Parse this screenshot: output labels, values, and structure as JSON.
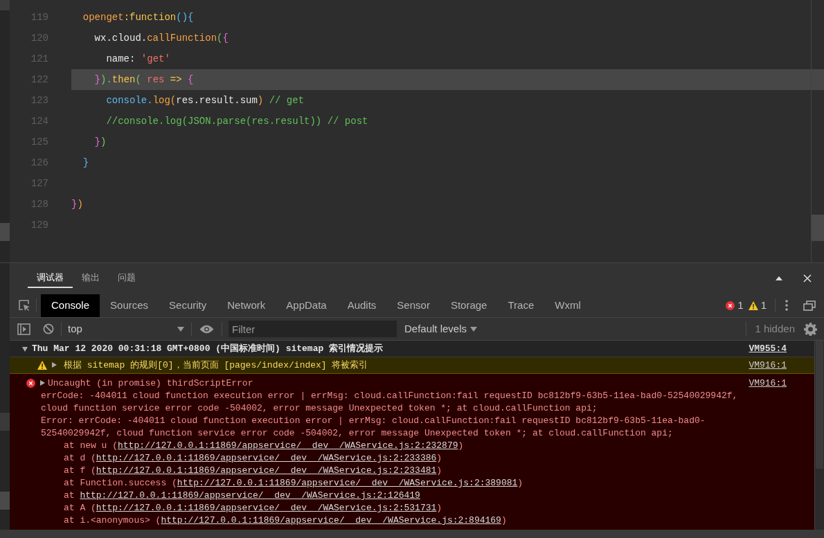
{
  "editor": {
    "lines": [
      {
        "number": "119",
        "current": false,
        "tokens": [
          {
            "t": "  openget",
            "color": "#f5a343"
          },
          {
            "t": ":function",
            "color": "#f7c948"
          },
          {
            "t": "(){",
            "color": "#5cb8f2"
          }
        ]
      },
      {
        "number": "120",
        "current": false,
        "tokens": [
          {
            "t": "    wx.cloud.",
            "color": "#e6e6e6"
          },
          {
            "t": "callFunction",
            "color": "#f5a343"
          },
          {
            "t": "(",
            "color": "#7fc46a"
          },
          {
            "t": "{",
            "color": "#e46bd6"
          }
        ]
      },
      {
        "number": "121",
        "current": false,
        "tokens": [
          {
            "t": "      name: ",
            "color": "#e6e6e6"
          },
          {
            "t": "'get'",
            "color": "#f0706a"
          }
        ]
      },
      {
        "number": "122",
        "current": true,
        "tokens": [
          {
            "t": "    }",
            "color": "#e46bd6"
          },
          {
            "t": ").",
            "color": "#7fc46a"
          },
          {
            "t": "then",
            "color": "#f7c948"
          },
          {
            "t": "( ",
            "color": "#7fc46a"
          },
          {
            "t": "res",
            "color": "#f0706a"
          },
          {
            "t": " => ",
            "color": "#f7c948"
          },
          {
            "t": "{",
            "color": "#e46bd6"
          }
        ]
      },
      {
        "number": "123",
        "current": false,
        "tokens": [
          {
            "t": "      console.",
            "color": "#5cb8f2"
          },
          {
            "t": "log(",
            "color": "#f5a343"
          },
          {
            "t": "res.result.sum",
            "color": "#e6e6e6"
          },
          {
            "t": ")",
            "color": "#f5a343"
          },
          {
            "t": " // get",
            "color": "#62c05a"
          }
        ]
      },
      {
        "number": "124",
        "current": false,
        "tokens": [
          {
            "t": "      //console.log(JSON.parse(res.result)) // post",
            "color": "#62c05a"
          }
        ]
      },
      {
        "number": "125",
        "current": false,
        "tokens": [
          {
            "t": "    }",
            "color": "#e46bd6"
          },
          {
            "t": ")",
            "color": "#7fc46a"
          }
        ]
      },
      {
        "number": "126",
        "current": false,
        "tokens": [
          {
            "t": "  }",
            "color": "#5cb8f2"
          }
        ]
      },
      {
        "number": "127",
        "current": false
      },
      {
        "number": "128",
        "current": false,
        "tokens": [
          {
            "t": "}",
            "color": "#e46bd6"
          },
          {
            "t": ")",
            "color": "#f5a343"
          }
        ]
      },
      {
        "number": "129",
        "current": false
      }
    ]
  },
  "panel_tabs": [
    {
      "label": "调试器",
      "selected": true
    },
    {
      "label": "输出",
      "selected": false
    },
    {
      "label": "问题",
      "selected": false
    }
  ],
  "devtools_tabs": [
    {
      "label": "Console",
      "selected": true
    },
    {
      "label": "Sources",
      "selected": false
    },
    {
      "label": "Security",
      "selected": false
    },
    {
      "label": "Network",
      "selected": false
    },
    {
      "label": "AppData",
      "selected": false
    },
    {
      "label": "Audits",
      "selected": false
    },
    {
      "label": "Sensor",
      "selected": false
    },
    {
      "label": "Storage",
      "selected": false
    },
    {
      "label": "Trace",
      "selected": false
    },
    {
      "label": "Wxml",
      "selected": false
    }
  ],
  "counts": {
    "errors": "1",
    "warnings": "1"
  },
  "toolbar": {
    "context": "top",
    "filter_placeholder": "Filter",
    "levels": "Default levels",
    "hidden": "1 hidden"
  },
  "messages": [
    {
      "kind": "group",
      "expanded": true,
      "text": "Thu Mar 12 2020 00:31:18 GMT+0800 (中国标准时间) sitemap 索引情况提示",
      "source": "VM955:4"
    },
    {
      "kind": "warning",
      "expanded": false,
      "text": "根据 sitemap 的规则[0]，当前页面 [pages/index/index] 将被索引",
      "source": "VM916:1"
    },
    {
      "kind": "error",
      "expanded": false,
      "text": "Uncaught (in promise) thirdScriptError",
      "source": "VM916:1",
      "lines": [
        "errCode: -404011 cloud function execution error | errMsg: cloud.callFunction:fail requestID bc812bf9-63b5-11ea-bad0-52540029942f,",
        "cloud function service error code -504002, error message Unexpected token *; at cloud.callFunction api;",
        "Error: errCode: -404011 cloud function execution error | errMsg: cloud.callFunction:fail requestID bc812bf9-63b5-11ea-bad0-",
        "52540029942f, cloud function service error code -504002, error message Unexpected token *; at cloud.callFunction api;"
      ],
      "stack": [
        {
          "prefix": "at new u (",
          "url": "http://127.0.0.1:11869/appservice/__dev__/WAService.js:2:232879",
          "suffix": ")"
        },
        {
          "prefix": "at d (",
          "url": "http://127.0.0.1:11869/appservice/__dev__/WAService.js:2:233386",
          "suffix": ")"
        },
        {
          "prefix": "at f (",
          "url": "http://127.0.0.1:11869/appservice/__dev__/WAService.js:2:233481",
          "suffix": ")"
        },
        {
          "prefix": "at Function.success (",
          "url": "http://127.0.0.1:11869/appservice/__dev__/WAService.js:2:389081",
          "suffix": ")"
        },
        {
          "prefix": "at ",
          "url": "http://127.0.0.1:11869/appservice/__dev__/WAService.js:2:126419"
        },
        {
          "prefix": "at A (",
          "url": "http://127.0.0.1:11869/appservice/__dev__/WAService.js:2:531731",
          "suffix": ")"
        },
        {
          "prefix": "at i.<anonymous> (",
          "url": "http://127.0.0.1:11869/appservice/__dev__/WAService.js:2:894169",
          "suffix": ")"
        }
      ]
    }
  ]
}
